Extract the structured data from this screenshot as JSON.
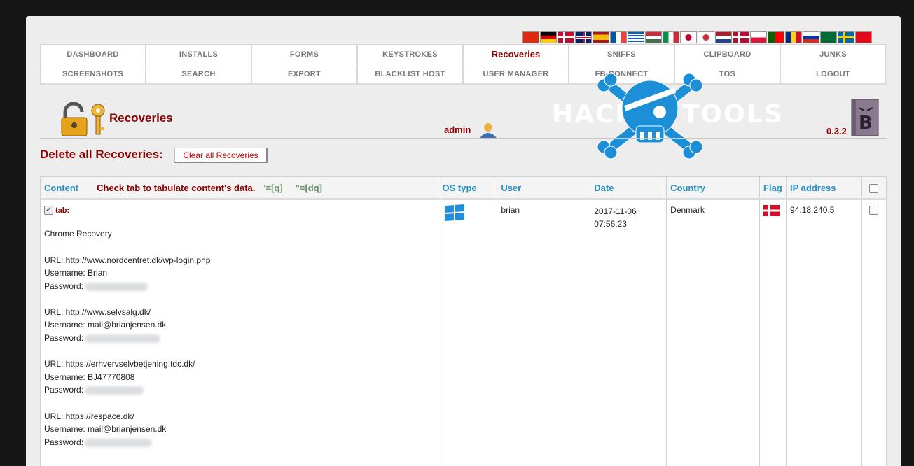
{
  "flags": [
    "cn",
    "de",
    "dk",
    "gb",
    "es",
    "fr",
    "gr",
    "hu",
    "it",
    "jp",
    "kr",
    "nl",
    "no",
    "pl",
    "pt",
    "ro",
    "ru",
    "sa",
    "se",
    "tr"
  ],
  "nav": {
    "row1": [
      "DASHBOARD",
      "INSTALLS",
      "FORMS",
      "KEYSTROKES",
      "Recoveries",
      "SNIFFS",
      "CLIPBOARD",
      "JUNKS"
    ],
    "row2": [
      "SCREENSHOTS",
      "SEARCH",
      "EXPORT",
      "BLACKLIST HOST",
      "USER MANAGER",
      "FB-CONNECT",
      "TOS",
      "LOGOUT"
    ],
    "active": "Recoveries"
  },
  "header": {
    "title": "Recoveries",
    "user": "admin",
    "version": "0.3.2",
    "logo_left": "HACK",
    "logo_right": "TOOLS"
  },
  "actions": {
    "delete_label": "Delete all Recoveries:",
    "clear_button": "Clear all Recoveries"
  },
  "table": {
    "headers": {
      "content": "Content",
      "hint": "Check tab to tabulate content's data.",
      "quote_single": "'=[q]",
      "quote_double": "\"=[dq]",
      "os": "OS type",
      "user": "User",
      "date": "Date",
      "country": "Country",
      "flag": "Flag",
      "ip": "IP address"
    },
    "rows": [
      {
        "tab_label": "tab:",
        "tab_checked": true,
        "recovery_type": "Chrome Recovery",
        "entries": [
          {
            "url": "URL: http://www.nordcentret.dk/wp-login.php",
            "username": "Username: Brian",
            "password": "Password:"
          },
          {
            "url": "URL: http://www.selvsalg.dk/",
            "username": "Username: mail@brianjensen.dk",
            "password": "Password:"
          },
          {
            "url": "URL: https://erhvervselvbetjening.tdc.dk/",
            "username": "Username: BJ47770808",
            "password": "Password:"
          },
          {
            "url": "URL: https://respace.dk/",
            "username": "Username: mail@brianjensen.dk",
            "password": "Password:"
          }
        ],
        "os": "windows-icon",
        "user": "brian",
        "date": "2017-11-06",
        "time": "07:56:23",
        "country": "Denmark",
        "flag": "dk",
        "ip": "94.18.240.5"
      }
    ]
  }
}
